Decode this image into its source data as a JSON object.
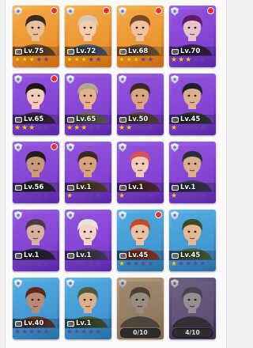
{
  "heroes": [
    {
      "level": "Lv.75",
      "stars": 3,
      "frame": "gold",
      "alert": true,
      "skin": "#e8c09c",
      "hair": "#3a2a22",
      "bg": "#f0a040",
      "cloth": "#6e4a2e"
    },
    {
      "level": "Lv.72",
      "stars": 3,
      "frame": "gold",
      "alert": true,
      "skin": "#f1cdb2",
      "hair": "#d8c6b0",
      "bg": "#f0a040",
      "cloth": "#4d5a72"
    },
    {
      "level": "Lv.68",
      "stars": 3,
      "frame": "gold",
      "alert": true,
      "skin": "#efc3a0",
      "hair": "#7a4a26",
      "bg": "#f0a040",
      "cloth": "#7b5a3a"
    },
    {
      "level": "Lv.70",
      "stars": 3,
      "frame": "purple",
      "alert": true,
      "skin": "#e6c3c8",
      "hair": "#5b1d6a",
      "bg": "#8e49d8",
      "cloth": "#3b234e"
    },
    {
      "level": "Lv.65",
      "stars": 3,
      "frame": "purple",
      "alert": true,
      "skin": "#f0cdb8",
      "hair": "#1d1518",
      "bg": "#8e49d8",
      "cloth": "#3a2a40"
    },
    {
      "level": "Lv.65",
      "stars": 3,
      "frame": "purple",
      "alert": false,
      "skin": "#e1b48c",
      "hair": "#b4a48a",
      "bg": "#8e49d8",
      "cloth": "#6d6a4e"
    },
    {
      "level": "Lv.50",
      "stars": 2,
      "frame": "purple",
      "alert": false,
      "skin": "#d9a480",
      "hair": "#3b2a22",
      "bg": "#8e49d8",
      "cloth": "#5b4a3e"
    },
    {
      "level": "Lv.45",
      "stars": 1,
      "frame": "purple",
      "alert": false,
      "skin": "#dcb08c",
      "hair": "#20202a",
      "bg": "#8e49d8",
      "cloth": "#2e3f34"
    },
    {
      "level": "Lv.56",
      "stars": 0,
      "frame": "purple",
      "alert": true,
      "skin": "#c99a7a",
      "hair": "#231d1d",
      "bg": "#8e49d8",
      "cloth": "#2e2a30"
    },
    {
      "level": "Lv.1",
      "stars": 1,
      "frame": "purple",
      "alert": false,
      "skin": "#d6a27c",
      "hair": "#3a2a20",
      "bg": "#8e49d8",
      "cloth": "#5a4632"
    },
    {
      "level": "Lv.1",
      "stars": 1,
      "frame": "purple",
      "alert": false,
      "skin": "#f2c8b8",
      "hair": "#d8515d",
      "bg": "#8e49d8",
      "cloth": "#5a2e3a"
    },
    {
      "level": "Lv.1",
      "stars": 1,
      "frame": "purple",
      "alert": false,
      "skin": "#d8ae8c",
      "hair": "#2a2e3a",
      "bg": "#8e49d8",
      "cloth": "#39405a"
    },
    {
      "level": "Lv.1",
      "stars": 0,
      "frame": "purple",
      "alert": false,
      "skin": "#d8b0a0",
      "hair": "#4a3a44",
      "bg": "#8e49d8",
      "cloth": "#2a2a3e"
    },
    {
      "level": "Lv.1",
      "stars": 0,
      "frame": "purple",
      "alert": false,
      "skin": "#f1d2c4",
      "hair": "#ece4da",
      "bg": "#8e49d8",
      "cloth": "#4e4560"
    },
    {
      "level": "Lv.45",
      "stars": 1,
      "frame": "blue",
      "alert": true,
      "skin": "#eebf9e",
      "hair": "#c24a2a",
      "bg": "#4aa3dc",
      "cloth": "#9a3a2a"
    },
    {
      "level": "Lv.45",
      "stars": 1,
      "frame": "blue",
      "alert": false,
      "skin": "#e5b894",
      "hair": "#3a4a2a",
      "bg": "#4aa3dc",
      "cloth": "#4e6a3a"
    },
    {
      "level": "Lv.40",
      "stars": 0,
      "frame": "blue",
      "alert": false,
      "skin": "#b88a72",
      "hair": "#5a2a22",
      "bg": "#4aa3dc",
      "cloth": "#6a3a2e"
    },
    {
      "level": "Lv.1",
      "stars": 0,
      "frame": "blue",
      "alert": false,
      "skin": "#dcae8a",
      "hair": "#4a5a3a",
      "bg": "#4aa3dc",
      "cloth": "#4a5a34"
    },
    {
      "level": "",
      "stars": 0,
      "frame": "gold",
      "locked": true,
      "progress": "0/10",
      "skin": "#c9a07a",
      "hair": "#6a4a2a",
      "bg": "#c8903c",
      "cloth": "#6a5034"
    },
    {
      "level": "",
      "stars": 0,
      "frame": "purple",
      "locked": true,
      "progress": "4/10",
      "skin": "#b9a2b4",
      "hair": "#5a4a7a",
      "bg": "#8e6ad0",
      "cloth": "#3e3452"
    }
  ]
}
